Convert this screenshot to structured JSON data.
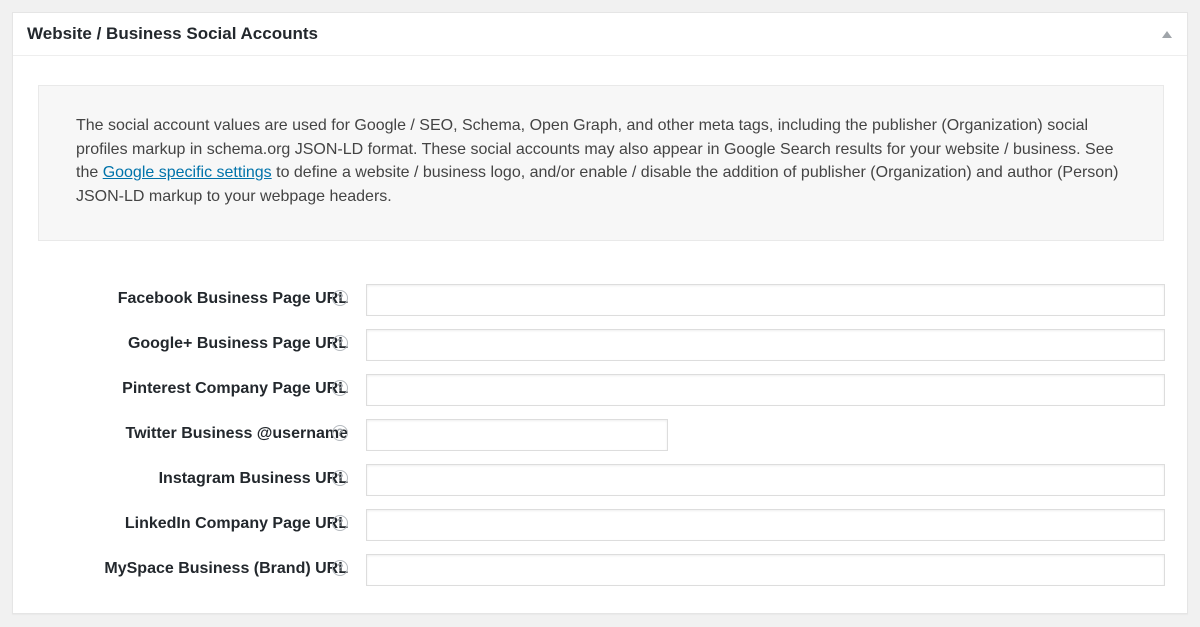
{
  "box": {
    "title": "Website / Business Social Accounts"
  },
  "info": {
    "text_before_link": "The social account values are used for Google / SEO, Schema, Open Graph, and other meta tags, including the publisher (Organization) social profiles markup in schema.org JSON-LD format. These social accounts may also appear in Google Search results for your website / business. See the ",
    "link_text": "Google specific settings",
    "text_after_link": " to define a website / business logo, and/or enable / disable the addition of publisher (Organization) and author (Person) JSON-LD markup to your webpage headers."
  },
  "fields": [
    {
      "label": "Facebook Business Page URL",
      "value": "",
      "placeholder": ""
    },
    {
      "label": "Google+ Business Page URL",
      "value": "",
      "placeholder": ""
    },
    {
      "label": "Pinterest Company Page URL",
      "value": "",
      "placeholder": ""
    },
    {
      "label": "Twitter Business @username",
      "value": "",
      "placeholder": ""
    },
    {
      "label": "Instagram Business URL",
      "value": "",
      "placeholder": ""
    },
    {
      "label": "LinkedIn Company Page URL",
      "value": "",
      "placeholder": ""
    },
    {
      "label": "MySpace Business (Brand) URL",
      "value": "",
      "placeholder": ""
    }
  ],
  "help_glyph": "?",
  "icons": {
    "toggle": "collapse-arrow-up-icon",
    "help": "question-circle-icon"
  },
  "colors": {
    "link": "#0073aa",
    "panel_background": "#ffffff",
    "info_background": "#f7f7f7"
  }
}
